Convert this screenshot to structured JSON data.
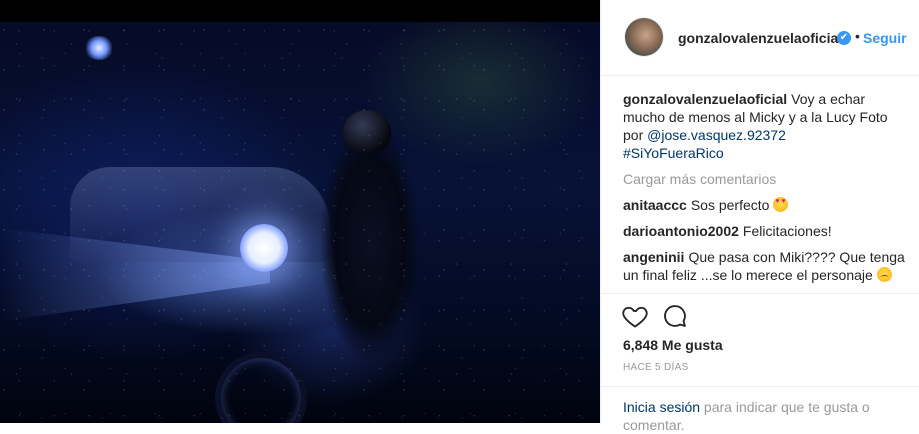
{
  "post": {
    "username": "gonzalovalenzuelaoficial",
    "follow_label": "Seguir",
    "verified_mark": "✔",
    "separator": "•"
  },
  "caption": {
    "username": "gonzalovalenzuelaoficial",
    "text": "Voy a echar mucho de menos al Micky y a la Lucy Foto por ",
    "mention": "@jose.vasquez.92372",
    "hashtag": "#SiYoFueraRico"
  },
  "load_more": "Cargar más comentarios",
  "comments": [
    {
      "username": "anitaaccc",
      "text": "Sos perfecto ",
      "emoji": "heart-eyes"
    },
    {
      "username": "darioantonio2002",
      "text": "Felicitaciones!"
    },
    {
      "username": "angeninii",
      "text": "Que pasa con Miki???? Que tenga un final feliz ...se lo merece el personaje ",
      "emoji": "sad"
    }
  ],
  "likes": "6,848 Me gusta",
  "time_ago": "Hace 5 días",
  "login_prompt": {
    "link": "Inicia sesión",
    "text": " para indicar que te gusta o comentar."
  },
  "icons": {
    "like": "heart-outline-icon",
    "comment": "speech-bubble-icon"
  }
}
